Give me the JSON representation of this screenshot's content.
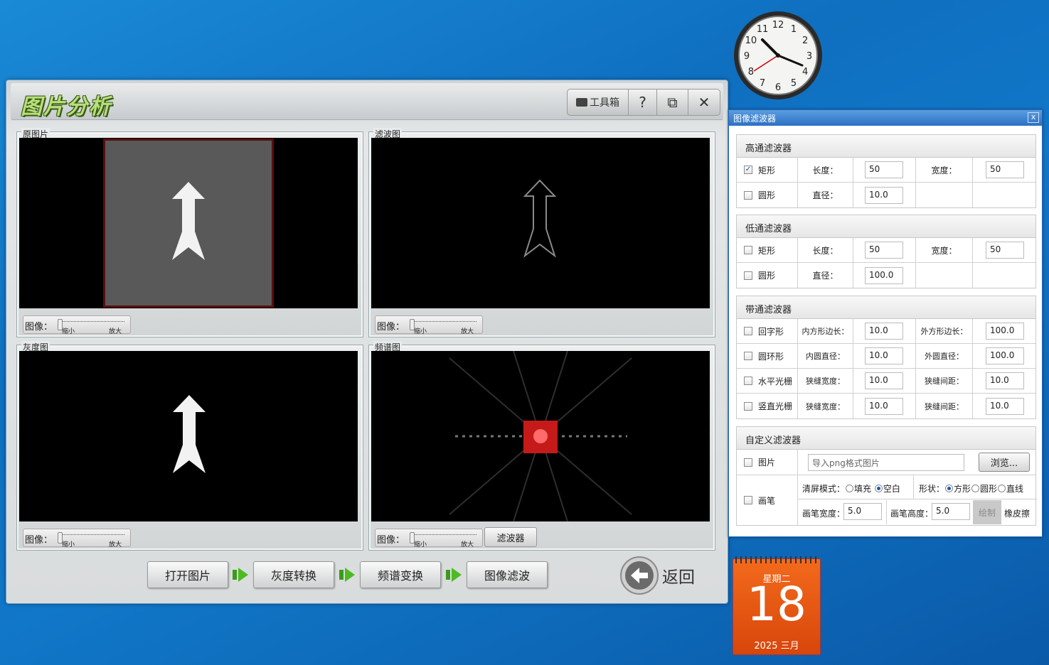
{
  "app": {
    "title": "图片分析",
    "toolbar": {
      "toolbox_label": "工具箱",
      "help_label": "?",
      "restore_label": "⧉",
      "close_label": "✕"
    },
    "panels": [
      {
        "label": "原图片",
        "slider_label": "图像：",
        "slider_min": "缩小",
        "slider_max": "放大"
      },
      {
        "label": "滤波图",
        "slider_label": "图像：",
        "slider_min": "缩小",
        "slider_max": "放大"
      },
      {
        "label": "灰度图",
        "slider_label": "图像：",
        "slider_min": "缩小",
        "slider_max": "放大"
      },
      {
        "label": "频谱图",
        "slider_label": "图像：",
        "slider_min": "缩小",
        "slider_max": "放大",
        "extra_button": "滤波器"
      }
    ],
    "steps": [
      "打开图片",
      "灰度转换",
      "频谱变换",
      "图像滤波"
    ],
    "back_label": "返回"
  },
  "filter_dialog": {
    "title": "图像滤波器",
    "close_label": "x",
    "highpass": {
      "title": "高通滤波器",
      "rect": {
        "checked": true,
        "label": "矩形",
        "len_label": "长度：",
        "len": "50",
        "wid_label": "宽度：",
        "wid": "50"
      },
      "circle": {
        "checked": false,
        "label": "圆形",
        "dia_label": "直径：",
        "dia": "10.0"
      }
    },
    "lowpass": {
      "title": "低通滤波器",
      "rect": {
        "checked": false,
        "label": "矩形",
        "len_label": "长度：",
        "len": "50",
        "wid_label": "宽度：",
        "wid": "50"
      },
      "circle": {
        "checked": false,
        "label": "圆形",
        "dia_label": "直径：",
        "dia": "100.0"
      }
    },
    "bandpass": {
      "title": "带通滤波器",
      "rows": [
        {
          "label": "回字形",
          "a_label": "内方形边长：",
          "a": "10.0",
          "b_label": "外方形边长：",
          "b": "100.0"
        },
        {
          "label": "圆环形",
          "a_label": "内圆直径：",
          "a": "10.0",
          "b_label": "外圆直径：",
          "b": "100.0"
        },
        {
          "label": "水平光栅",
          "a_label": "狭缝宽度：",
          "a": "10.0",
          "b_label": "狭缝间距：",
          "b": "10.0"
        },
        {
          "label": "竖直光栅",
          "a_label": "狭缝宽度：",
          "a": "10.0",
          "b_label": "狭缝间距：",
          "b": "10.0"
        }
      ]
    },
    "custom": {
      "title": "自定义滤波器",
      "image_label": "图片",
      "image_placeholder": "导入png格式图片",
      "browse_label": "浏览...",
      "pen_label": "画笔",
      "clear_label": "清屏模式：",
      "clear_opt1": "填充",
      "clear_opt2": "空白",
      "shape_label": "形状：",
      "shape_opt1": "方形",
      "shape_opt2": "圆形",
      "shape_opt3": "直线",
      "pen_width_label": "画笔宽度：",
      "pen_width": "5.0",
      "pen_height_label": "画笔高度：",
      "pen_height": "5.0",
      "draw_label": "绘制",
      "eraser_label": "橡皮擦"
    }
  },
  "calendar": {
    "weekday": "星期二",
    "day": "18",
    "year_month": "2025 三月"
  },
  "clock": {
    "numbers": [
      "12",
      "1",
      "2",
      "3",
      "4",
      "5",
      "6",
      "7",
      "8",
      "9",
      "10",
      "11"
    ]
  }
}
